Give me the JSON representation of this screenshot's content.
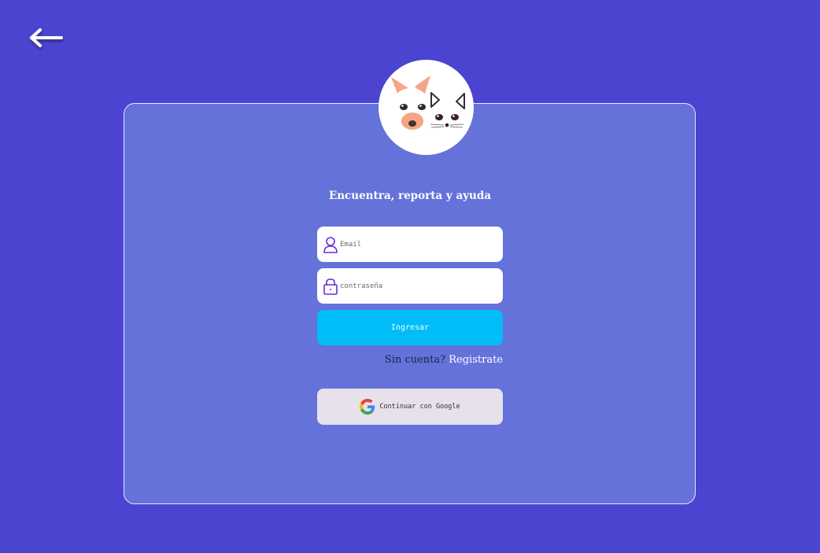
{
  "nav": {
    "back_icon": "arrow-left-icon"
  },
  "brand": {
    "logo_icon": "dog-cat-logo-icon"
  },
  "tagline": "Encuentra, reporta y ayuda",
  "form": {
    "email": {
      "icon": "user-icon",
      "placeholder": "Email",
      "value": ""
    },
    "password": {
      "icon": "lock-icon",
      "placeholder": "contraseña",
      "value": ""
    },
    "submit_label": "Ingresar",
    "signup_prompt": "Sin cuenta?",
    "signup_link": "Registrate",
    "google": {
      "icon": "google-icon",
      "label": "Continuar con Google"
    }
  },
  "colors": {
    "background": "#4b44d1",
    "card": "#6472da",
    "primary_button": "#00bdf8",
    "icon_accent": "#6a2bd8"
  }
}
